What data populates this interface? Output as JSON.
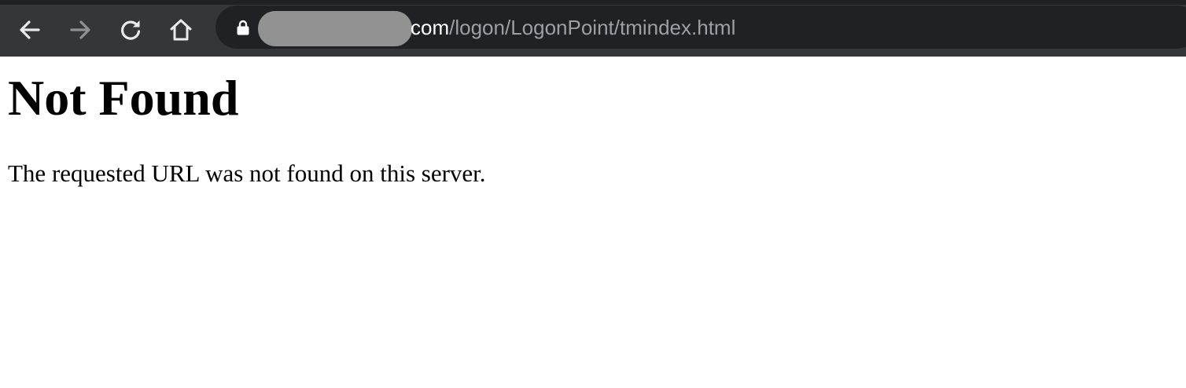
{
  "browser": {
    "icons": {
      "back": "arrow-left-icon",
      "forward": "arrow-right-icon",
      "reload": "reload-icon",
      "home": "home-icon",
      "secure": "lock-icon"
    },
    "url_host_suffix": "com",
    "url_path": "/logon/LogonPoint/tmindex.html"
  },
  "page": {
    "heading": "Not Found",
    "message": "The requested URL was not found on this server."
  }
}
